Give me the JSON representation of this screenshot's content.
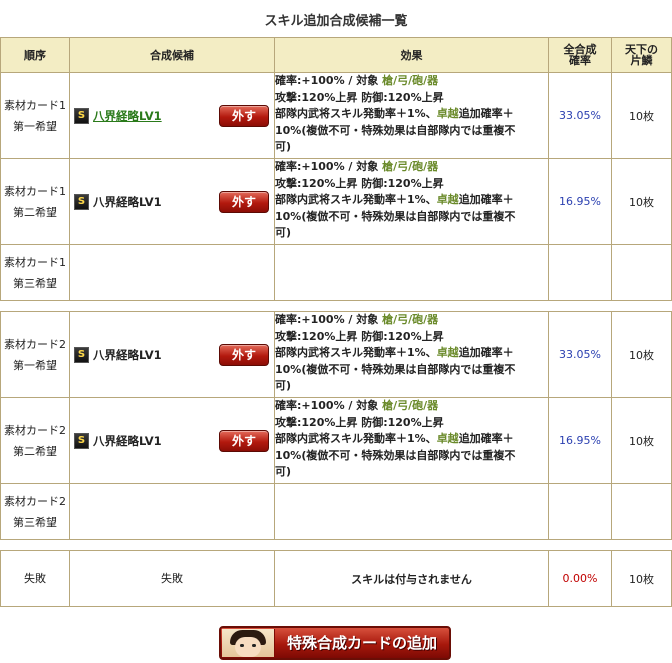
{
  "title": "スキル追加合成候補一覧",
  "headers": {
    "order": "順序",
    "candidate": "合成候補",
    "effect": "効果",
    "total_rate_1": "全合成",
    "total_rate_2": "確率",
    "shards_1": "天下の",
    "shards_2": "片鱗"
  },
  "remove_label": "外す",
  "group1": [
    {
      "label1": "素材カード1",
      "label2": "第一希望",
      "icon": "S",
      "skill": "八界経略LV1",
      "skill_link": true,
      "eff_rate": "確率:+100% / 対象 ",
      "eff_target": "槍/弓/砲/器",
      "eff_l2": "攻撃:120%上昇 防御:120%上昇",
      "eff_l3a": "部隊内武将スキル発動率＋1%、",
      "eff_l3b": "卓越",
      "eff_l3c": "追加確率＋",
      "eff_l4": "10%(複倣不可・特殊効果は自部隊内では重複不",
      "eff_l5": "可)",
      "rate": "33.05%",
      "count": "10枚"
    },
    {
      "label1": "素材カード1",
      "label2": "第二希望",
      "icon": "S",
      "skill": "八界経略LV1",
      "skill_link": false,
      "eff_rate": "確率:+100% / 対象 ",
      "eff_target": "槍/弓/砲/器",
      "eff_l2": "攻撃:120%上昇 防御:120%上昇",
      "eff_l3a": "部隊内武将スキル発動率＋1%、",
      "eff_l3b": "卓越",
      "eff_l3c": "追加確率＋",
      "eff_l4": "10%(複倣不可・特殊効果は自部隊内では重複不",
      "eff_l5": "可)",
      "rate": "16.95%",
      "count": "10枚"
    },
    {
      "label1": "素材カード1",
      "label2": "第三希望"
    }
  ],
  "group2": [
    {
      "label1": "素材カード2",
      "label2": "第一希望",
      "icon": "S",
      "skill": "八界経略LV1",
      "skill_link": false,
      "eff_rate": "確率:+100% / 対象 ",
      "eff_target": "槍/弓/砲/器",
      "eff_l2": "攻撃:120%上昇 防御:120%上昇",
      "eff_l3a": "部隊内武将スキル発動率＋1%、",
      "eff_l3b": "卓越",
      "eff_l3c": "追加確率＋",
      "eff_l4": "10%(複倣不可・特殊効果は自部隊内では重複不",
      "eff_l5": "可)",
      "rate": "33.05%",
      "count": "10枚"
    },
    {
      "label1": "素材カード2",
      "label2": "第二希望",
      "icon": "S",
      "skill": "八界経略LV1",
      "skill_link": false,
      "eff_rate": "確率:+100% / 対象 ",
      "eff_target": "槍/弓/砲/器",
      "eff_l2": "攻撃:120%上昇 防御:120%上昇",
      "eff_l3a": "部隊内武将スキル発動率＋1%、",
      "eff_l3b": "卓越",
      "eff_l3c": "追加確率＋",
      "eff_l4": "10%(複倣不可・特殊効果は自部隊内では重複不",
      "eff_l5": "可)",
      "rate": "16.95%",
      "count": "10枚"
    },
    {
      "label1": "素材カード2",
      "label2": "第三希望"
    }
  ],
  "failure": {
    "order": "失敗",
    "candidate": "失敗",
    "effect": "スキルは付与されません",
    "rate": "0.00%",
    "count": "10枚"
  },
  "add_button": "特殊合成カードの追加"
}
